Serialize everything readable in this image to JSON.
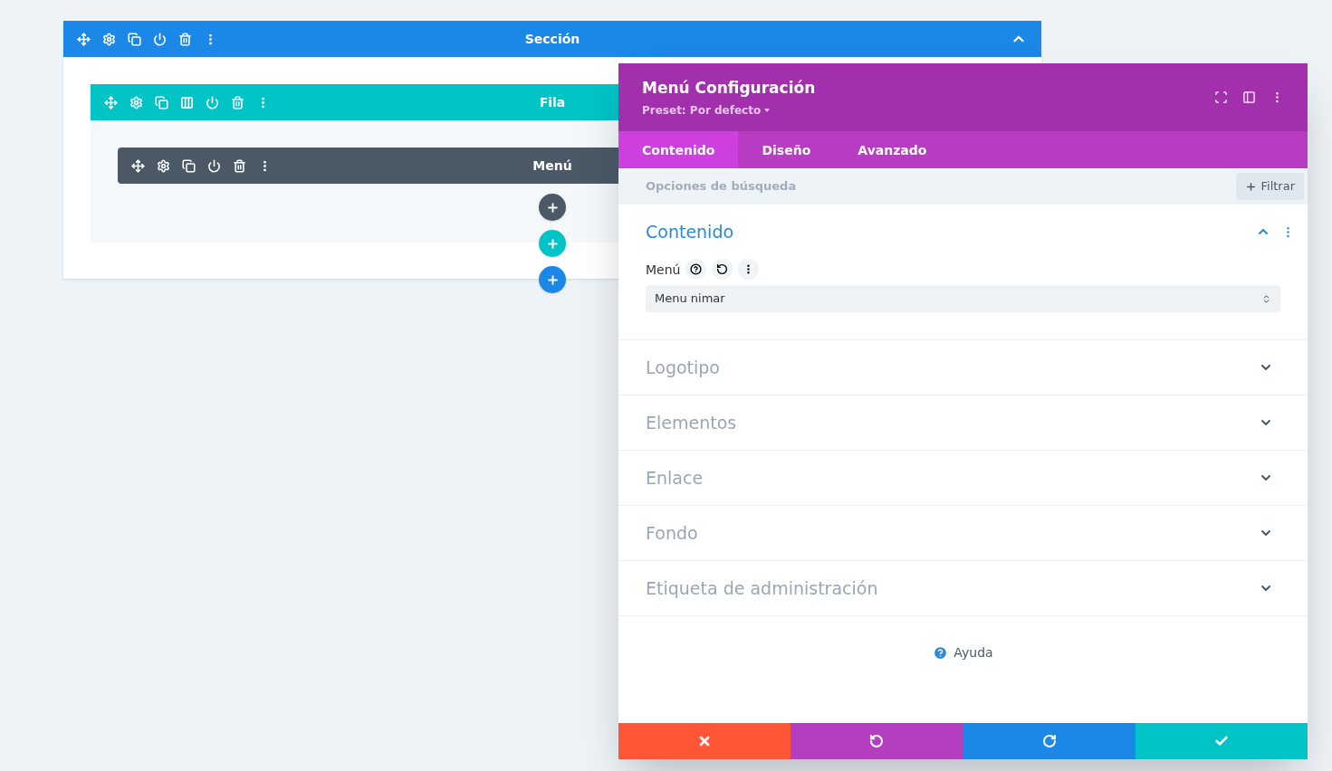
{
  "builder": {
    "section": {
      "title": "Sección",
      "expanded": true
    },
    "row": {
      "title": "Fila"
    },
    "module": {
      "title": "Menú"
    }
  },
  "panel": {
    "title": "Menú Configuración",
    "preset": "Preset: Por defecto",
    "tabs": [
      {
        "label": "Contenido",
        "selected": true
      },
      {
        "label": "Diseño",
        "selected": false
      },
      {
        "label": "Avanzado",
        "selected": false
      }
    ],
    "search": {
      "placeholder": "Opciones de búsqueda"
    },
    "filter_button": "Filtrar",
    "groups": [
      {
        "title": "Contenido",
        "expanded": true,
        "field": {
          "label": "Menú",
          "value": "Menu nimar"
        }
      },
      {
        "title": "Logotipo",
        "expanded": false
      },
      {
        "title": "Elementos",
        "expanded": false
      },
      {
        "title": "Enlace",
        "expanded": false
      },
      {
        "title": "Fondo",
        "expanded": false
      },
      {
        "title": "Etiqueta de administración",
        "expanded": false
      }
    ],
    "help": "Ayuda"
  }
}
